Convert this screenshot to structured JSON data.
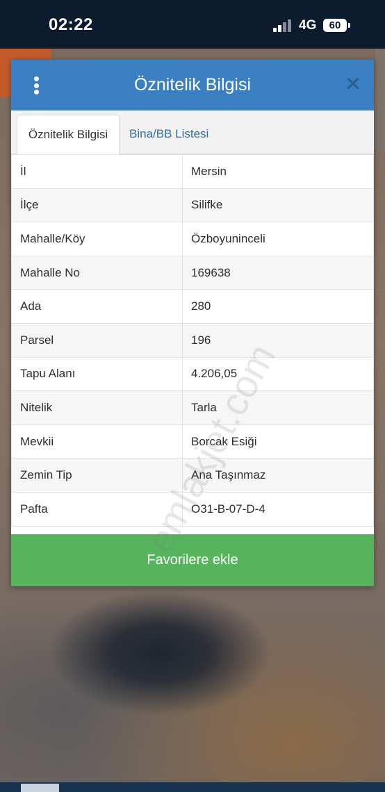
{
  "status_bar": {
    "time": "02:22",
    "network": "4G",
    "battery": "60"
  },
  "dialog": {
    "title": "Öznitelik Bilgisi",
    "menu_icon": "more-vertical-icon",
    "close_icon": "close-icon",
    "tabs": [
      {
        "label": "Öznitelik Bilgisi",
        "active": true
      },
      {
        "label": "Bina/BB Listesi",
        "active": false
      }
    ],
    "rows": [
      {
        "key": "İl",
        "value": "Mersin"
      },
      {
        "key": "İlçe",
        "value": "Silifke"
      },
      {
        "key": "Mahalle/Köy",
        "value": "Özboyuninceli"
      },
      {
        "key": "Mahalle No",
        "value": "169638"
      },
      {
        "key": "Ada",
        "value": "280"
      },
      {
        "key": "Parsel",
        "value": "196"
      },
      {
        "key": "Tapu Alanı",
        "value": "4.206,05"
      },
      {
        "key": "Nitelik",
        "value": "Tarla"
      },
      {
        "key": "Mevkii",
        "value": "Borcak Esiği"
      },
      {
        "key": "Zemin Tip",
        "value": "Ana Taşınmaz"
      },
      {
        "key": "Pafta",
        "value": "O31-B-07-D-4"
      }
    ],
    "favorite_button": "Favorilere ekle"
  },
  "watermark": "emlakjet.com",
  "colors": {
    "header": "#3a7fc1",
    "button": "#56b45d",
    "tab_link": "#2f6ea8"
  }
}
